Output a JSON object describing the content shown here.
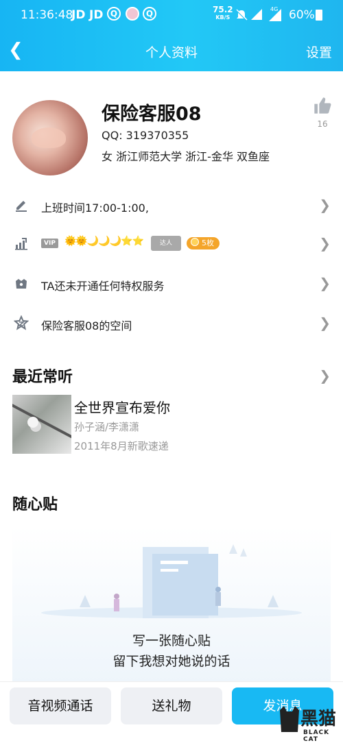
{
  "status_bar": {
    "time": "11:36:48",
    "app1": "JD",
    "app2": "JD",
    "speed": "75.2",
    "speed_unit": "KB/S",
    "network": "4G",
    "battery": "60%"
  },
  "nav": {
    "title": "个人资料",
    "settings": "设置"
  },
  "profile": {
    "name": "保险客服08",
    "qq": "QQ:  319370355",
    "info": "女  浙江师范大学  浙江-金华  双鱼座",
    "likes": "16"
  },
  "rows": {
    "signature": "上班时间17:00-1:00,",
    "vip_badge": "VIP",
    "level_icons": "🌞🌞🌙🌙🌙⭐⭐",
    "daren": "达人",
    "coins": "5枚",
    "privilege": "TA还未开通任何特权服务",
    "space": "保险客服08的空间"
  },
  "music": {
    "section_title": "最近常听",
    "song": "全世界宣布爱你",
    "artist": "孙子涵/李潇潇",
    "album": "2011年8月新歌速递"
  },
  "notes": {
    "section_title": "随心贴",
    "line1": "写一张随心贴",
    "line2": "留下我想对她说的话"
  },
  "actions": {
    "call": "音视频通话",
    "gift": "送礼物",
    "message": "发消息"
  },
  "watermark": {
    "text": "黑猫",
    "sub": "BLACK CAT"
  },
  "colors": {
    "accent": "#18b9f3"
  }
}
